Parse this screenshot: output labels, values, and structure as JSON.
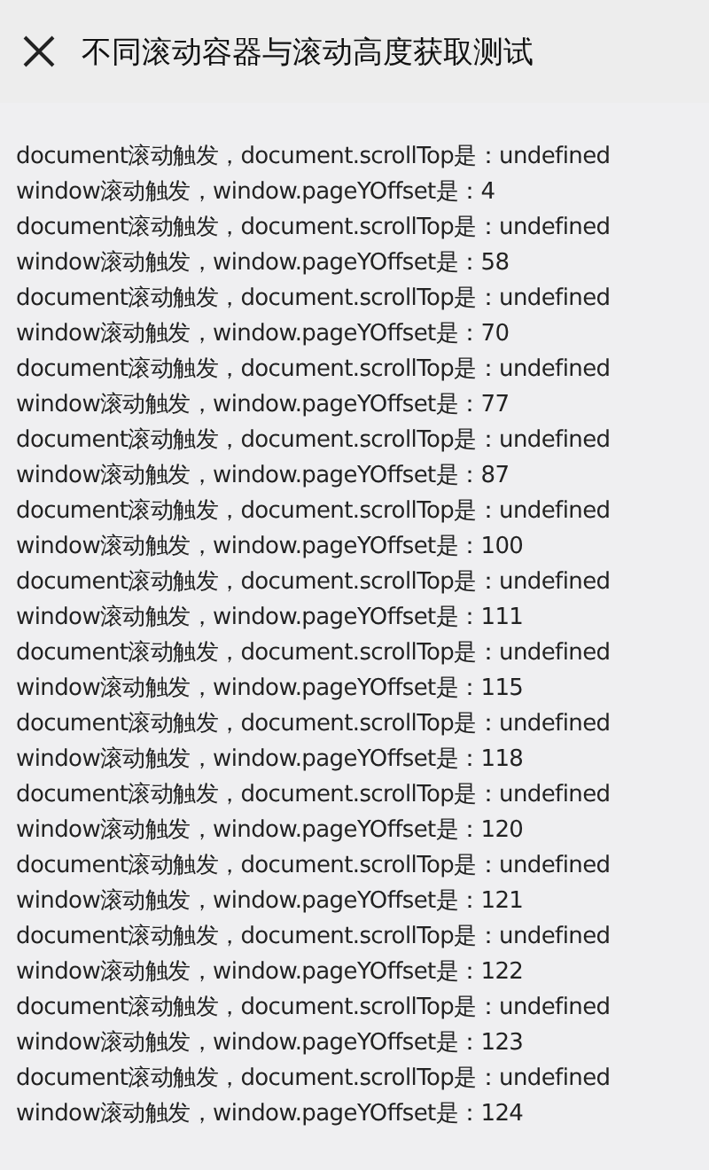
{
  "header": {
    "title": "不同滚动容器与滚动高度获取测试"
  },
  "log_lines": [
    "document滚动触发，document.scrollTop是：undefined",
    "window滚动触发，window.pageYOffset是：4",
    "document滚动触发，document.scrollTop是：undefined",
    "window滚动触发，window.pageYOffset是：58",
    "document滚动触发，document.scrollTop是：undefined",
    "window滚动触发，window.pageYOffset是：70",
    "document滚动触发，document.scrollTop是：undefined",
    "window滚动触发，window.pageYOffset是：77",
    "document滚动触发，document.scrollTop是：undefined",
    "window滚动触发，window.pageYOffset是：87",
    "document滚动触发，document.scrollTop是：undefined",
    "window滚动触发，window.pageYOffset是：100",
    "document滚动触发，document.scrollTop是：undefined",
    "window滚动触发，window.pageYOffset是：111",
    "document滚动触发，document.scrollTop是：undefined",
    "window滚动触发，window.pageYOffset是：115",
    "document滚动触发，document.scrollTop是：undefined",
    "window滚动触发，window.pageYOffset是：118",
    "document滚动触发，document.scrollTop是：undefined",
    "window滚动触发，window.pageYOffset是：120",
    "document滚动触发，document.scrollTop是：undefined",
    "window滚动触发，window.pageYOffset是：121",
    "document滚动触发，document.scrollTop是：undefined",
    "window滚动触发，window.pageYOffset是：122",
    "document滚动触发，document.scrollTop是：undefined",
    "window滚动触发，window.pageYOffset是：123",
    "document滚动触发，document.scrollTop是：undefined",
    "window滚动触发，window.pageYOffset是：124"
  ]
}
